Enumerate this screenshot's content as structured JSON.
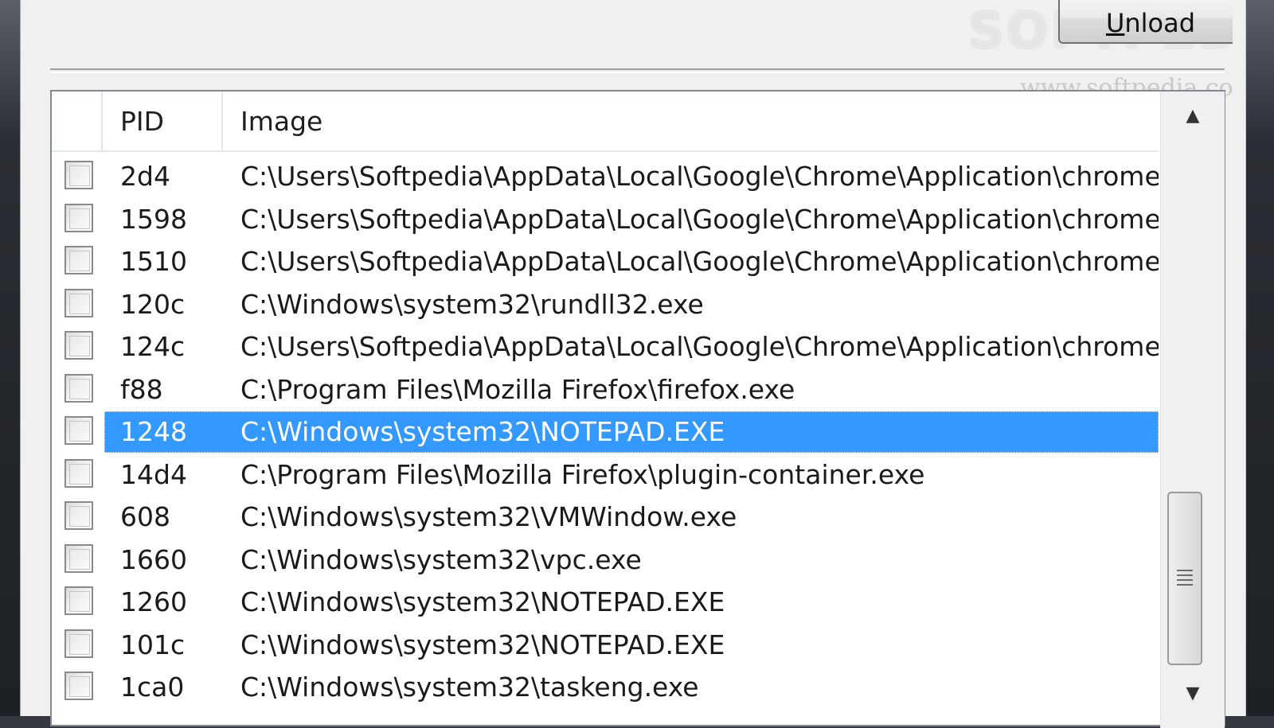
{
  "toolbar": {
    "unload_mnemonic": "U",
    "unload_rest": "nload"
  },
  "watermark": {
    "logo_text": "SOFTPEDIA",
    "url": "www.softpedia.com"
  },
  "process_list": {
    "columns": {
      "check": "",
      "pid": "PID",
      "image": "Image"
    },
    "rows": [
      {
        "pid": "2d4",
        "image": "C:\\Users\\Softpedia\\AppData\\Local\\Google\\Chrome\\Application\\chrome.exe",
        "checked": false,
        "selected": false
      },
      {
        "pid": "1598",
        "image": "C:\\Users\\Softpedia\\AppData\\Local\\Google\\Chrome\\Application\\chrome.exe",
        "checked": false,
        "selected": false
      },
      {
        "pid": "1510",
        "image": "C:\\Users\\Softpedia\\AppData\\Local\\Google\\Chrome\\Application\\chrome.exe",
        "checked": false,
        "selected": false
      },
      {
        "pid": "120c",
        "image": "C:\\Windows\\system32\\rundll32.exe",
        "checked": false,
        "selected": false
      },
      {
        "pid": "124c",
        "image": "C:\\Users\\Softpedia\\AppData\\Local\\Google\\Chrome\\Application\\chrome.exe",
        "checked": false,
        "selected": false
      },
      {
        "pid": "f88",
        "image": "C:\\Program Files\\Mozilla Firefox\\firefox.exe",
        "checked": false,
        "selected": false
      },
      {
        "pid": "1248",
        "image": "C:\\Windows\\system32\\NOTEPAD.EXE",
        "checked": false,
        "selected": true
      },
      {
        "pid": "14d4",
        "image": "C:\\Program Files\\Mozilla Firefox\\plugin-container.exe",
        "checked": false,
        "selected": false
      },
      {
        "pid": "608",
        "image": "C:\\Windows\\system32\\VMWindow.exe",
        "checked": false,
        "selected": false
      },
      {
        "pid": "1660",
        "image": "C:\\Windows\\system32\\vpc.exe",
        "checked": false,
        "selected": false
      },
      {
        "pid": "1260",
        "image": "C:\\Windows\\system32\\NOTEPAD.EXE",
        "checked": false,
        "selected": false
      },
      {
        "pid": "101c",
        "image": "C:\\Windows\\system32\\NOTEPAD.EXE",
        "checked": false,
        "selected": false
      },
      {
        "pid": "1ca0",
        "image": "C:\\Windows\\system32\\taskeng.exe",
        "checked": false,
        "selected": false
      }
    ]
  },
  "scrollbar": {
    "up_icon": "scroll-up-arrow-icon",
    "down_icon": "scroll-down-arrow-icon"
  },
  "colors": {
    "selection": "#3399ff",
    "dialog_bg": "#f0f0f0",
    "list_bg": "#ffffff"
  }
}
